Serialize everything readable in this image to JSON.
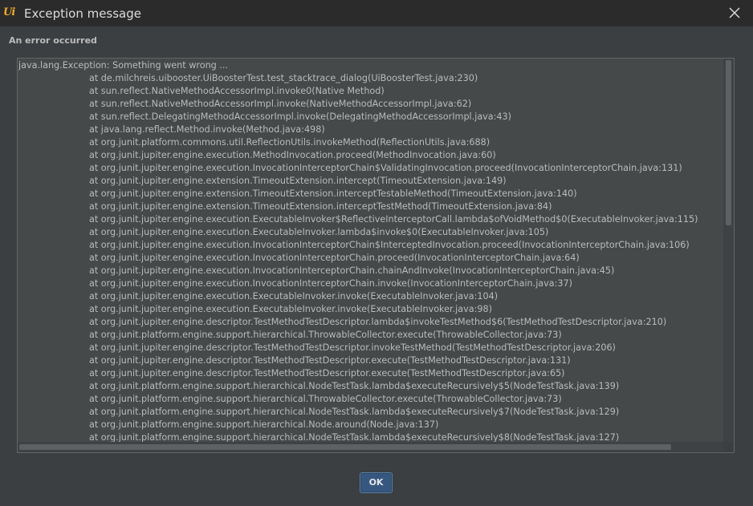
{
  "window": {
    "title": "Exception message",
    "app_icon": "uibooster-logo-icon",
    "close_icon": "close-icon"
  },
  "dialog": {
    "heading": "An error occurred",
    "trace_lines": [
      "java.lang.Exception: Something went wrong ...",
      "at de.milchreis.uibooster.UiBoosterTest.test_stacktrace_dialog(UiBoosterTest.java:230)",
      "at sun.reflect.NativeMethodAccessorImpl.invoke0(Native Method)",
      "at sun.reflect.NativeMethodAccessorImpl.invoke(NativeMethodAccessorImpl.java:62)",
      "at sun.reflect.DelegatingMethodAccessorImpl.invoke(DelegatingMethodAccessorImpl.java:43)",
      "at java.lang.reflect.Method.invoke(Method.java:498)",
      "at org.junit.platform.commons.util.ReflectionUtils.invokeMethod(ReflectionUtils.java:688)",
      "at org.junit.jupiter.engine.execution.MethodInvocation.proceed(MethodInvocation.java:60)",
      "at org.junit.jupiter.engine.execution.InvocationInterceptorChain$ValidatingInvocation.proceed(InvocationInterceptorChain.java:131)",
      "at org.junit.jupiter.engine.extension.TimeoutExtension.intercept(TimeoutExtension.java:149)",
      "at org.junit.jupiter.engine.extension.TimeoutExtension.interceptTestableMethod(TimeoutExtension.java:140)",
      "at org.junit.jupiter.engine.extension.TimeoutExtension.interceptTestMethod(TimeoutExtension.java:84)",
      "at org.junit.jupiter.engine.execution.ExecutableInvoker$ReflectiveInterceptorCall.lambda$ofVoidMethod$0(ExecutableInvoker.java:115)",
      "at org.junit.jupiter.engine.execution.ExecutableInvoker.lambda$invoke$0(ExecutableInvoker.java:105)",
      "at org.junit.jupiter.engine.execution.InvocationInterceptorChain$InterceptedInvocation.proceed(InvocationInterceptorChain.java:106)",
      "at org.junit.jupiter.engine.execution.InvocationInterceptorChain.proceed(InvocationInterceptorChain.java:64)",
      "at org.junit.jupiter.engine.execution.InvocationInterceptorChain.chainAndInvoke(InvocationInterceptorChain.java:45)",
      "at org.junit.jupiter.engine.execution.InvocationInterceptorChain.invoke(InvocationInterceptorChain.java:37)",
      "at org.junit.jupiter.engine.execution.ExecutableInvoker.invoke(ExecutableInvoker.java:104)",
      "at org.junit.jupiter.engine.execution.ExecutableInvoker.invoke(ExecutableInvoker.java:98)",
      "at org.junit.jupiter.engine.descriptor.TestMethodTestDescriptor.lambda$invokeTestMethod$6(TestMethodTestDescriptor.java:210)",
      "at org.junit.platform.engine.support.hierarchical.ThrowableCollector.execute(ThrowableCollector.java:73)",
      "at org.junit.jupiter.engine.descriptor.TestMethodTestDescriptor.invokeTestMethod(TestMethodTestDescriptor.java:206)",
      "at org.junit.jupiter.engine.descriptor.TestMethodTestDescriptor.execute(TestMethodTestDescriptor.java:131)",
      "at org.junit.jupiter.engine.descriptor.TestMethodTestDescriptor.execute(TestMethodTestDescriptor.java:65)",
      "at org.junit.platform.engine.support.hierarchical.NodeTestTask.lambda$executeRecursively$5(NodeTestTask.java:139)",
      "at org.junit.platform.engine.support.hierarchical.ThrowableCollector.execute(ThrowableCollector.java:73)",
      "at org.junit.platform.engine.support.hierarchical.NodeTestTask.lambda$executeRecursively$7(NodeTestTask.java:129)",
      "at org.junit.platform.engine.support.hierarchical.Node.around(Node.java:137)",
      "at org.junit.platform.engine.support.hierarchical.NodeTestTask.lambda$executeRecursively$8(NodeTestTask.java:127)"
    ]
  },
  "buttons": {
    "ok_label": "OK"
  },
  "colors": {
    "background": "#3c3f41",
    "titlebar": "#2b2b2b",
    "text": "#bbbbbb",
    "accent_button": "#365880"
  }
}
